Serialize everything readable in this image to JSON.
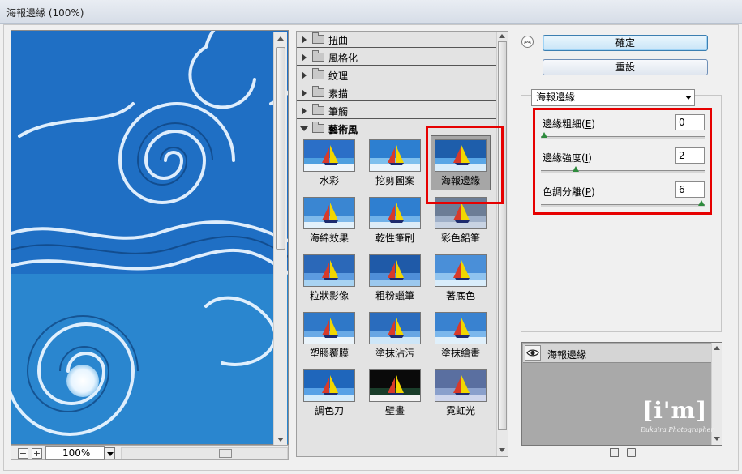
{
  "window": {
    "title": "海報邊緣 (100%)"
  },
  "preview": {
    "zoom_out": "−",
    "zoom_in": "+",
    "zoom_level": "100%"
  },
  "gallery": {
    "categories": [
      {
        "label": "扭曲",
        "expanded": false
      },
      {
        "label": "風格化",
        "expanded": false
      },
      {
        "label": "紋理",
        "expanded": false
      },
      {
        "label": "素描",
        "expanded": false
      },
      {
        "label": "筆觸",
        "expanded": false
      },
      {
        "label": "藝術風",
        "expanded": true
      }
    ],
    "filters": [
      "水彩",
      "挖剪圖案",
      "海報邊緣",
      "海綿效果",
      "乾性筆刷",
      "彩色鉛筆",
      "粒狀影像",
      "粗粉蠟筆",
      "著底色",
      "塑膠覆膜",
      "塗抹沾污",
      "塗抹繪畫",
      "調色刀",
      "壁畫",
      "霓虹光"
    ],
    "selected_filter": "海報邊緣"
  },
  "buttons": {
    "ok": "確定",
    "reset": "重設"
  },
  "filter_select": {
    "value": "海報邊緣"
  },
  "params": [
    {
      "label": "邊緣粗細(",
      "key": "E",
      "suffix": ")",
      "value": "0",
      "level": 0
    },
    {
      "label": "邊緣強度(",
      "key": "I",
      "suffix": ")",
      "value": "2",
      "level": 0.2
    },
    {
      "label": "色調分離(",
      "key": "P",
      "suffix": ")",
      "value": "6",
      "level": 1
    }
  ],
  "layers": {
    "items": [
      {
        "name": "海報邊緣",
        "visible": true
      }
    ]
  },
  "watermark": {
    "logo": "[i'm]",
    "tagline": "Eukaira Photographer"
  },
  "colors": {
    "accent_red": "#e60000",
    "slider_handle": "#2e8b3d"
  }
}
